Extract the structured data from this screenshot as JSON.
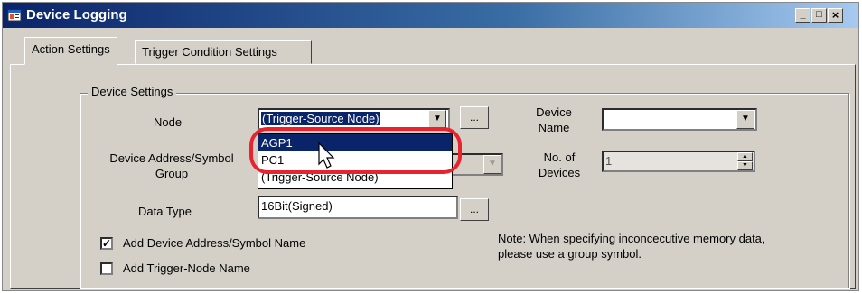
{
  "window": {
    "title": "Device Logging",
    "controls": {
      "minimize": "_",
      "maximize": "□",
      "close": "×"
    }
  },
  "tabs": [
    {
      "label": "Action Settings"
    },
    {
      "label": "Trigger Condition Settings"
    }
  ],
  "group": {
    "label": "Device Settings"
  },
  "node": {
    "label": "Node",
    "value": "(Trigger-Source Node)",
    "browse": "...",
    "options": [
      "AGP1",
      "PC1",
      "(Trigger-Source Node)"
    ],
    "highlighted": "AGP1"
  },
  "device_name": {
    "label_line1": "Device",
    "label_line2": "Name",
    "value": ""
  },
  "address": {
    "label_line1": "Device Address/Symbol",
    "label_line2": "Group"
  },
  "num_devices": {
    "label_line1": "No. of",
    "label_line2": "Devices",
    "value": "1"
  },
  "data_type": {
    "label": "Data Type",
    "value": "16Bit(Signed)",
    "browse": "..."
  },
  "checkboxes": [
    {
      "label": "Add Device Address/Symbol Name",
      "checked": true
    },
    {
      "label": "Add Trigger-Node Name",
      "checked": false
    }
  ],
  "note": "Note: When specifying inconcecutive memory data, please use a group symbol.",
  "icons": {
    "app": "window-app-icon",
    "dropdown": "chevron-down-icon",
    "cursor": "pointer-cursor-icon"
  }
}
